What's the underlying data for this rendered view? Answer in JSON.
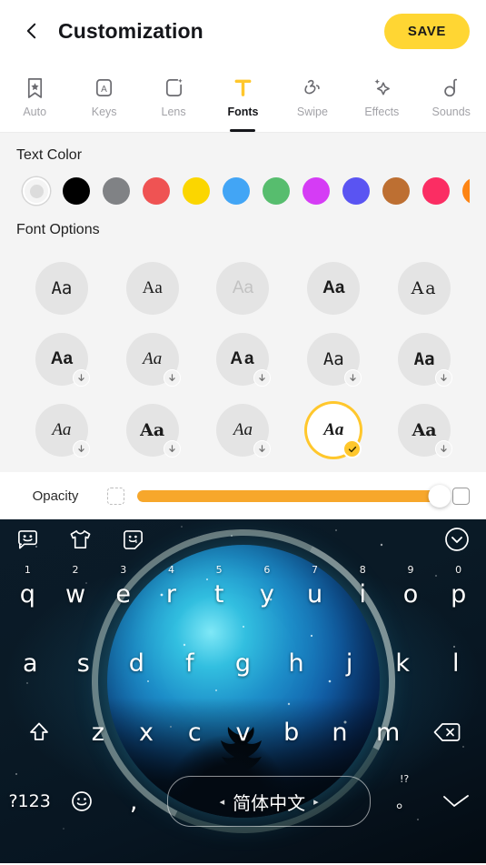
{
  "header": {
    "back_icon": "chevron-left-icon",
    "title": "Customization",
    "save_label": "SAVE",
    "save_color": "#ffd633"
  },
  "tabs": [
    {
      "label": "Auto",
      "icon": "bookmark-star-icon",
      "active": false
    },
    {
      "label": "Keys",
      "icon": "key-letter-icon",
      "active": false
    },
    {
      "label": "Lens",
      "icon": "lens-sparkle-icon",
      "active": false
    },
    {
      "label": "Fonts",
      "icon": "font-t-icon",
      "active": true
    },
    {
      "label": "Swipe",
      "icon": "swipe-hand-icon",
      "active": false
    },
    {
      "label": "Effects",
      "icon": "sparkles-icon",
      "active": false
    },
    {
      "label": "Sounds",
      "icon": "note-icon",
      "active": false
    }
  ],
  "text_color": {
    "title": "Text Color",
    "swatches": [
      {
        "color": "#dcdcdc",
        "selected": true,
        "name": "default"
      },
      {
        "color": "#000000",
        "selected": false,
        "name": "black"
      },
      {
        "color": "#808285",
        "selected": false,
        "name": "gray"
      },
      {
        "color": "#ef5353",
        "selected": false,
        "name": "red"
      },
      {
        "color": "#fbd600",
        "selected": false,
        "name": "yellow"
      },
      {
        "color": "#42a5f5",
        "selected": false,
        "name": "blue"
      },
      {
        "color": "#57bd6e",
        "selected": false,
        "name": "green"
      },
      {
        "color": "#d53cf5",
        "selected": false,
        "name": "magenta"
      },
      {
        "color": "#5a54f2",
        "selected": false,
        "name": "indigo"
      },
      {
        "color": "#bd6f32",
        "selected": false,
        "name": "brown"
      },
      {
        "color": "#fb2d63",
        "selected": false,
        "name": "pink"
      },
      {
        "color": "#fd8413",
        "selected": false,
        "name": "orange"
      }
    ]
  },
  "font_options": {
    "title": "Font Options",
    "selected_color": "#ffc72c",
    "items": [
      {
        "sample": "Aa",
        "style": "f-mono",
        "downloadable": false,
        "selected": false
      },
      {
        "sample": "Aa",
        "style": "f-serif",
        "downloadable": false,
        "selected": false
      },
      {
        "sample": "Aa",
        "style": "f-light",
        "downloadable": false,
        "selected": false
      },
      {
        "sample": "Aa",
        "style": "f-bold",
        "downloadable": false,
        "selected": false
      },
      {
        "sample": "Aa",
        "style": "f-dserif f-wide",
        "downloadable": false,
        "selected": false
      },
      {
        "sample": "Aa",
        "style": "f-bold",
        "downloadable": true,
        "selected": false
      },
      {
        "sample": "Aa",
        "style": "f-serif f-ital",
        "downloadable": true,
        "selected": false
      },
      {
        "sample": "Aa",
        "style": "f-bold f-wide",
        "downloadable": true,
        "selected": false
      },
      {
        "sample": "Aa",
        "style": "f-mono",
        "downloadable": true,
        "selected": false
      },
      {
        "sample": "Aa",
        "style": "f-bold f-mono",
        "downloadable": true,
        "selected": false
      },
      {
        "sample": "Aa",
        "style": "f-serif f-ital",
        "downloadable": true,
        "selected": false
      },
      {
        "sample": "Aa",
        "style": "f-dserif f-bold",
        "downloadable": true,
        "selected": false
      },
      {
        "sample": "Aa",
        "style": "f-serif f-ital",
        "downloadable": true,
        "selected": false
      },
      {
        "sample": "Aa",
        "style": "f-serif f-ital f-bold",
        "downloadable": false,
        "selected": true
      },
      {
        "sample": "Aa",
        "style": "f-dserif f-bold",
        "downloadable": true,
        "selected": false
      }
    ],
    "download_icon": "download-arrow-icon",
    "selected_icon": "check-icon"
  },
  "opacity": {
    "label": "Opacity",
    "min_icon": "transparent-square-icon",
    "max_icon": "opaque-square-icon",
    "value": 100,
    "fill_color": "#f7a72b"
  },
  "keyboard": {
    "toolbar": [
      {
        "icon": "sticker-face-icon"
      },
      {
        "icon": "tshirt-theme-icon"
      },
      {
        "icon": "emoji-sticker-icon"
      },
      {
        "icon": "chevron-down-circle-icon"
      }
    ],
    "row1": [
      {
        "key": "q",
        "hint": "1"
      },
      {
        "key": "w",
        "hint": "2"
      },
      {
        "key": "e",
        "hint": "3"
      },
      {
        "key": "r",
        "hint": "4"
      },
      {
        "key": "t",
        "hint": "5"
      },
      {
        "key": "y",
        "hint": "6"
      },
      {
        "key": "u",
        "hint": "7"
      },
      {
        "key": "i",
        "hint": "8"
      },
      {
        "key": "o",
        "hint": "9"
      },
      {
        "key": "p",
        "hint": "0"
      }
    ],
    "row2": [
      {
        "key": "a"
      },
      {
        "key": "s"
      },
      {
        "key": "d"
      },
      {
        "key": "f"
      },
      {
        "key": "g"
      },
      {
        "key": "h"
      },
      {
        "key": "j"
      },
      {
        "key": "k"
      },
      {
        "key": "l"
      }
    ],
    "row3": [
      {
        "key": "z"
      },
      {
        "key": "x"
      },
      {
        "key": "c"
      },
      {
        "key": "v"
      },
      {
        "key": "b"
      },
      {
        "key": "n"
      },
      {
        "key": "m"
      }
    ],
    "shift_icon": "shift-arrow-icon",
    "backspace_icon": "backspace-icon",
    "symbols_label": "?123",
    "emoji_icon": "smiley-icon",
    "comma_label": ",",
    "space_label": "简体中文",
    "space_left_arrow": "◂",
    "space_right_arrow": "▸",
    "period_label": "。",
    "period_hint": "!?",
    "enter_icon": "enter-icon"
  }
}
